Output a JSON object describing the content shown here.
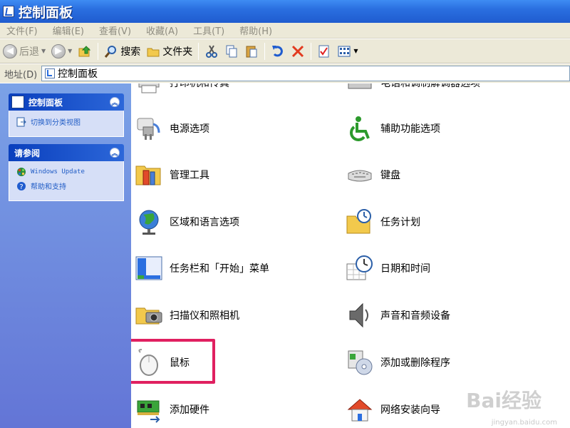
{
  "window": {
    "title": "控制面板"
  },
  "menu": [
    "文件(F)",
    "编辑(E)",
    "查看(V)",
    "收藏(A)",
    "工具(T)",
    "帮助(H)"
  ],
  "toolbar": {
    "back_label": "后退",
    "search_label": "搜索",
    "folders_label": "文件夹"
  },
  "address": {
    "label": "地址(D)",
    "value": "控制面板"
  },
  "taskpane": {
    "panel1": {
      "title": "控制面板",
      "links": [
        "切换到分类视图"
      ]
    },
    "panel2": {
      "title": "请参阅",
      "links": [
        "Windows Update",
        "帮助和支持"
      ]
    }
  },
  "items": {
    "row0_left": "打印机和传真",
    "row0_right": "电话和调制解调器选项",
    "row1_left": "电源选项",
    "row1_right": "辅助功能选项",
    "row2_left": "管理工具",
    "row2_right": "键盘",
    "row3_left": "区域和语言选项",
    "row3_right": "任务计划",
    "row4_left": "任务栏和「开始」菜单",
    "row4_right": "日期和时间",
    "row5_left": "扫描仪和照相机",
    "row5_right": "声音和音频设备",
    "row6_left": "鼠标",
    "row6_right": "添加或删除程序",
    "row7_left": "添加硬件",
    "row7_right": "网络安装向导"
  },
  "watermark": {
    "brand": "Bai经验",
    "url": "jingyan.baidu.com"
  },
  "colors": {
    "title_bar": "#2a6fe0",
    "highlight": "#e02060",
    "task_pane": "#6f8fdf"
  }
}
